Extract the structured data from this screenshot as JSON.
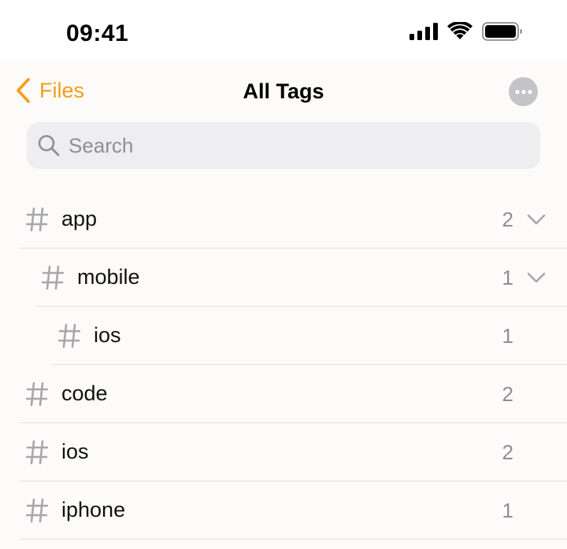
{
  "status_bar": {
    "time": "09:41",
    "icons": [
      "cellular-signal-icon",
      "wifi-icon",
      "battery-icon"
    ]
  },
  "nav": {
    "back_label": "Files",
    "title": "All Tags",
    "more_icon": "ellipsis-icon"
  },
  "search": {
    "placeholder": "Search",
    "value": ""
  },
  "colors": {
    "accent": "#f29d1c",
    "secondary_text": "#8e8e93",
    "background": "#fcfbf9"
  },
  "tags": [
    {
      "name": "app",
      "count": "2",
      "level": 0,
      "expandable": true
    },
    {
      "name": "mobile",
      "count": "1",
      "level": 1,
      "expandable": true
    },
    {
      "name": "ios",
      "count": "1",
      "level": 2,
      "expandable": false
    },
    {
      "name": "code",
      "count": "2",
      "level": 0,
      "expandable": false
    },
    {
      "name": "ios",
      "count": "2",
      "level": 0,
      "expandable": false
    },
    {
      "name": "iphone",
      "count": "1",
      "level": 0,
      "expandable": false
    }
  ]
}
